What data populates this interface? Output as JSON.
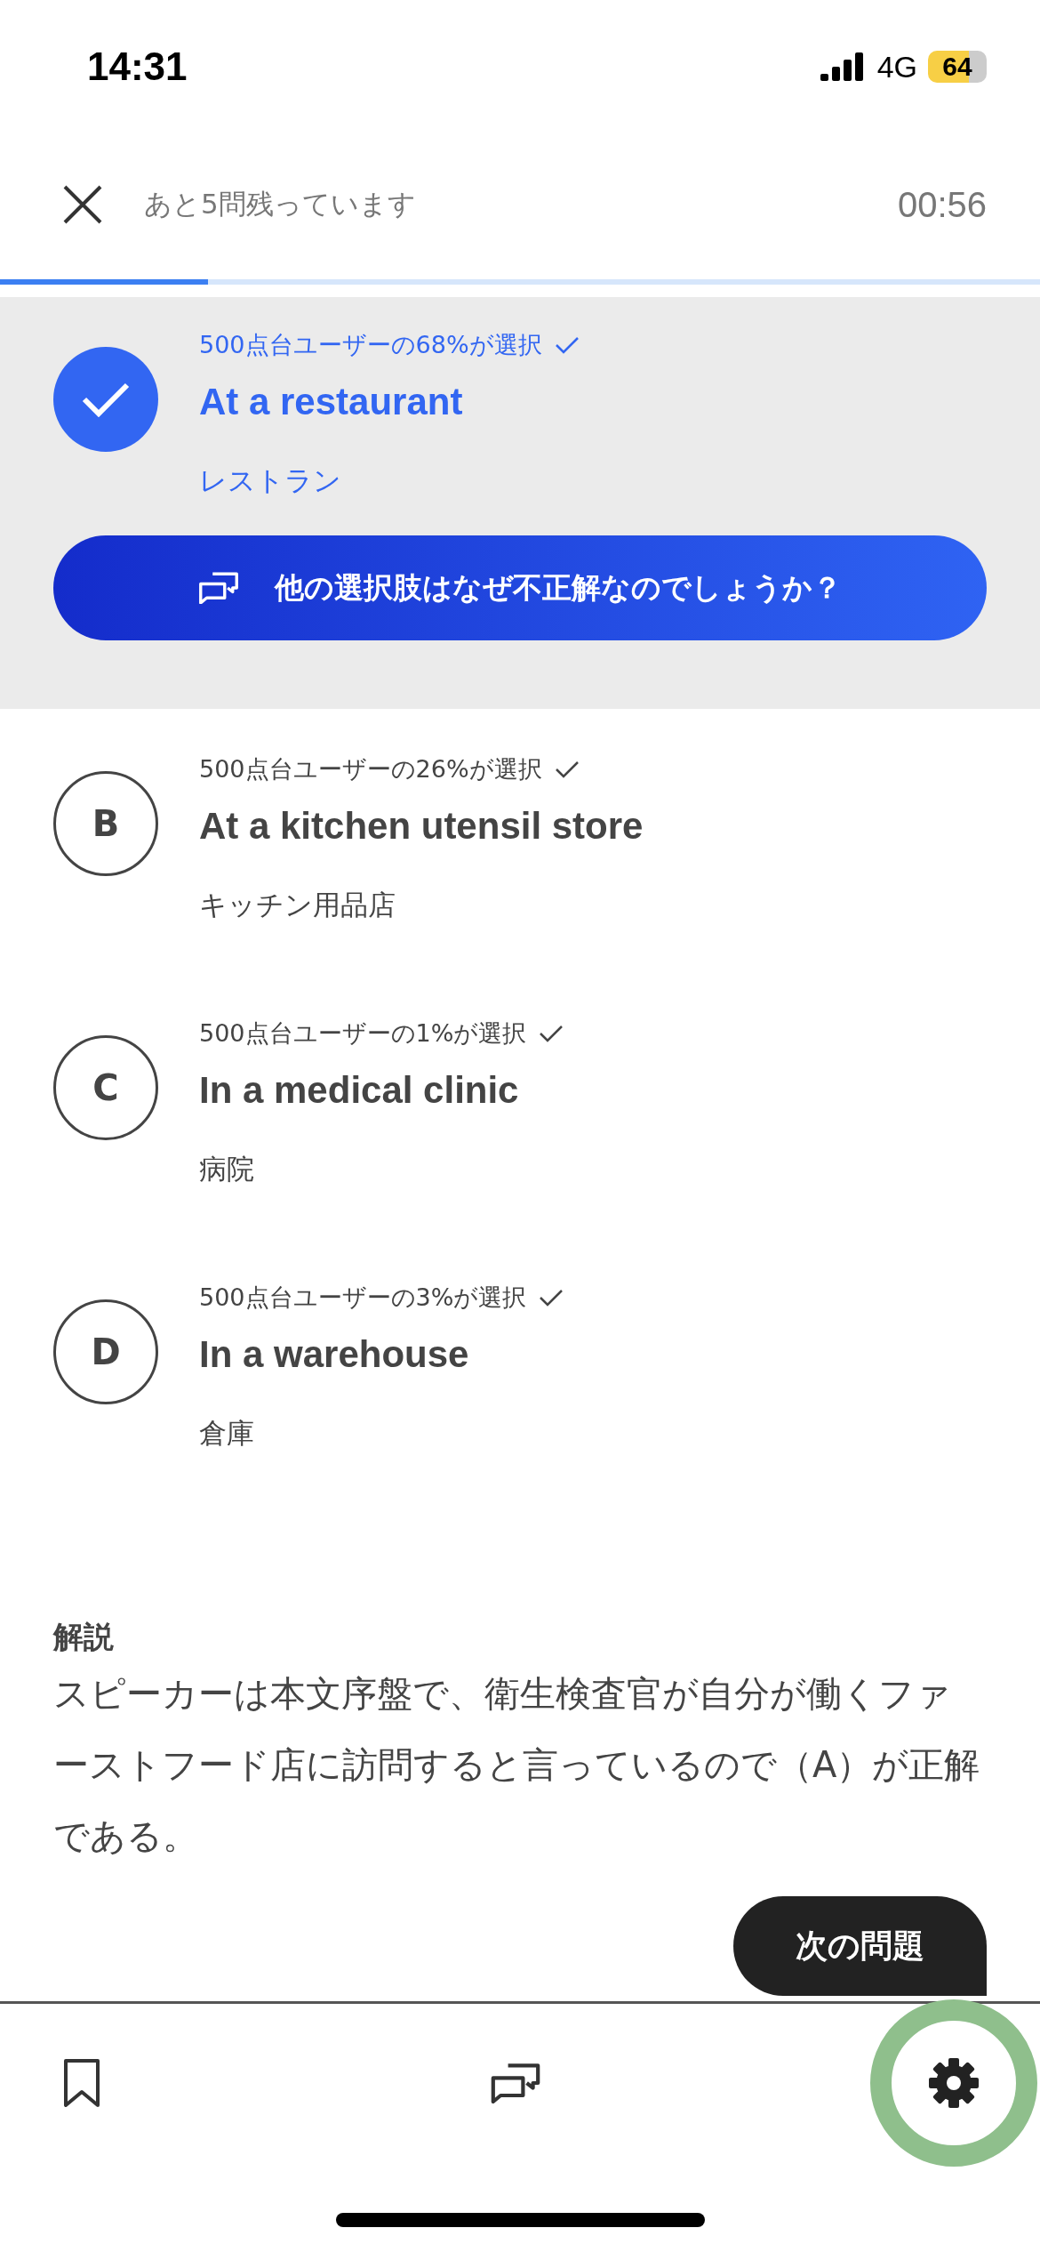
{
  "status_bar": {
    "time": "14:31",
    "network": "4G",
    "battery": "64"
  },
  "header": {
    "remaining": "あと5問残っています",
    "timer": "00:56"
  },
  "progress": {
    "level": 0.2
  },
  "options": [
    {
      "selected": true,
      "stats": "500点台ユーザーの68%が選択",
      "text": "At a restaurant",
      "translation": "レストラン"
    },
    {
      "letter": "B",
      "selected": false,
      "stats": "500点台ユーザーの26%が選択",
      "text": "At a kitchen utensil store",
      "translation": "キッチン用品店"
    },
    {
      "letter": "C",
      "selected": false,
      "stats": "500点台ユーザーの1%が選択",
      "text": "In a medical clinic",
      "translation": "病院"
    },
    {
      "letter": "D",
      "selected": false,
      "stats": "500点台ユーザーの3%が選択",
      "text": "In a warehouse",
      "translation": "倉庫"
    }
  ],
  "why_button": "他の選択肢はなぜ不正解なのでしょうか？",
  "explanation": {
    "heading": "解説",
    "body": "スピーカーは本文序盤で、衛生検査官が自分が働くファーストフード店に訪問すると言っているので（A）が正解である。"
  },
  "next_button": "次の問題",
  "bottom_nav": {
    "settings_highlighted": true
  }
}
